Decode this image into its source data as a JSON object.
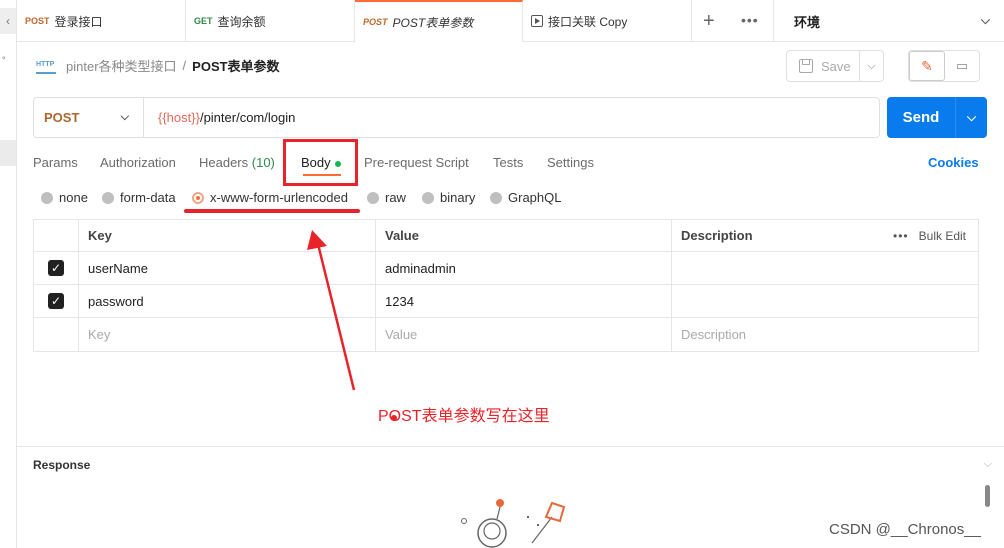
{
  "tabs": [
    {
      "method": "POST",
      "title": "登录接口"
    },
    {
      "method": "GET",
      "title": "查询余额"
    },
    {
      "method": "POST",
      "title": "POST表单参数"
    },
    {
      "method": "",
      "title": "接口关联 Copy"
    }
  ],
  "environment": {
    "label": "环境"
  },
  "breadcrumb": {
    "collection": "pinter各种类型接口",
    "separator": "/",
    "request": "POST表单参数",
    "http_badge": "HTTP"
  },
  "toolbar": {
    "save_label": "Save"
  },
  "request": {
    "method": "POST",
    "url_variable": "{{host}}",
    "url_path": "/pinter/com/login",
    "send_label": "Send"
  },
  "request_tabs": {
    "params": "Params",
    "authorization": "Authorization",
    "headers": "Headers",
    "headers_count": "(10)",
    "body": "Body",
    "prerequest": "Pre-request Script",
    "tests": "Tests",
    "settings": "Settings",
    "cookies": "Cookies"
  },
  "body_modes": {
    "none": "none",
    "form_data": "form-data",
    "urlencoded": "x-www-form-urlencoded",
    "raw": "raw",
    "binary": "binary",
    "graphql": "GraphQL",
    "selected": "x-www-form-urlencoded"
  },
  "table": {
    "headers": {
      "key": "Key",
      "value": "Value",
      "description": "Description",
      "bulk_edit": "Bulk Edit"
    },
    "rows": [
      {
        "checked": true,
        "key": "userName",
        "value": "adminadmin",
        "description": ""
      },
      {
        "checked": true,
        "key": "password",
        "value": "1234",
        "description": ""
      }
    ],
    "placeholder": {
      "key": "Key",
      "value": "Value",
      "description": "Description"
    }
  },
  "annotation": "POST表单参数写在这里",
  "response": {
    "title": "Response"
  },
  "watermark": "CSDN @__Chronos__",
  "colors": {
    "accent": "#ff6c37",
    "send": "#097bed",
    "annotation": "#e8242a",
    "variable": "#e36b55"
  }
}
